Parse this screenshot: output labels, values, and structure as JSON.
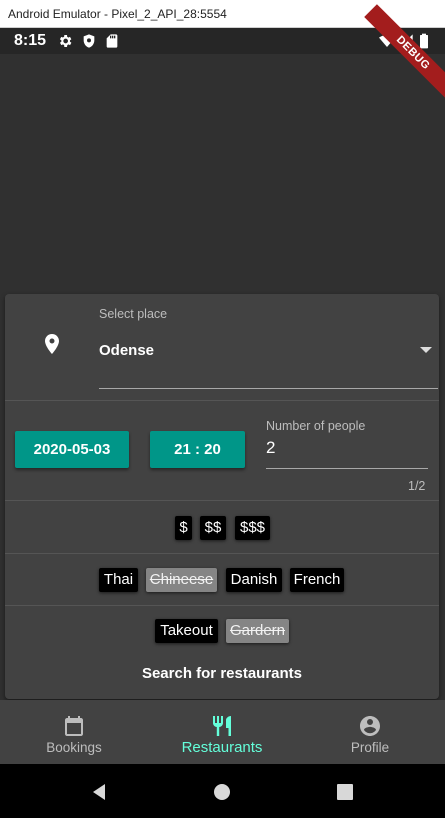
{
  "window": {
    "title": "Android Emulator - Pixel_2_API_28:5554"
  },
  "status_bar": {
    "time": "8:15",
    "icons": [
      "gear-icon",
      "shield-icon",
      "sd-card-icon",
      "wifi-icon",
      "signal-icon",
      "battery-icon"
    ],
    "debug_banner": "DEBUG"
  },
  "place": {
    "label": "Select place",
    "value": "Odense"
  },
  "datetime": {
    "date": "2020-05-03",
    "time": "21 : 20"
  },
  "people": {
    "label": "Number of people",
    "value": "2",
    "counter": "1/2"
  },
  "price_chips": [
    {
      "label": "$",
      "selected": true
    },
    {
      "label": "$$",
      "selected": true
    },
    {
      "label": "$$$",
      "selected": true
    }
  ],
  "cuisine_chips": [
    {
      "label": "Thai",
      "selected": true
    },
    {
      "label": "Chineese",
      "selected": false
    },
    {
      "label": "Danish",
      "selected": true
    },
    {
      "label": "French",
      "selected": true
    }
  ],
  "service_chips": [
    {
      "label": "Takeout",
      "selected": true
    },
    {
      "label": "Gardern",
      "selected": false
    }
  ],
  "search_label": "Search for restaurants",
  "bottom_nav": {
    "items": [
      {
        "label": "Bookings",
        "icon": "calendar-icon",
        "active": false
      },
      {
        "label": "Restaurants",
        "icon": "restaurant-icon",
        "active": true
      },
      {
        "label": "Profile",
        "icon": "account-circle-icon",
        "active": false
      }
    ]
  },
  "colors": {
    "accent": "#009688",
    "active_nav": "#64ffda",
    "surface": "#424242",
    "background": "#303030",
    "debug_ribbon": "#a31d1d"
  }
}
